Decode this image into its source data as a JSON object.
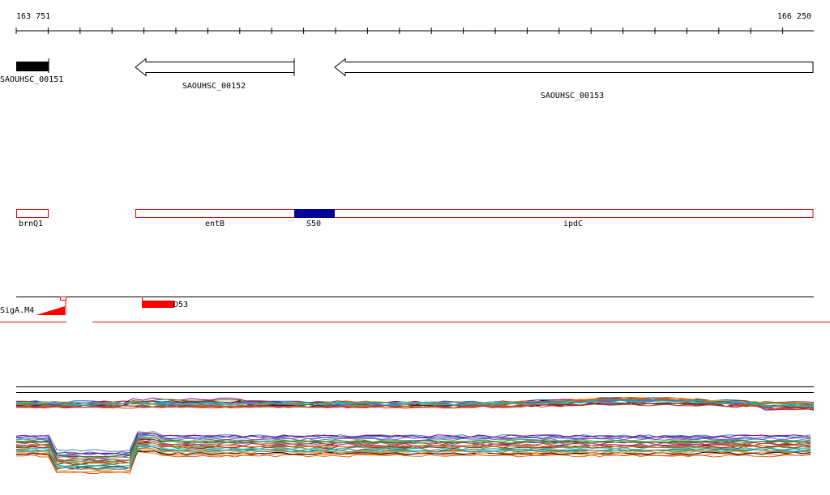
{
  "coordinates": {
    "start": "163 751",
    "end": "166 250"
  },
  "genes": [
    {
      "id": "SAOUHSC_00151",
      "strand": "+",
      "style": "filled"
    },
    {
      "id": "SAOUHSC_00152",
      "strand": "-",
      "style": "open-arrow"
    },
    {
      "id": "SAOUHSC_00153",
      "strand": "-",
      "style": "open-arrow"
    }
  ],
  "annotations": [
    {
      "name": "brnQ1",
      "color": "#e00000",
      "fill": "none"
    },
    {
      "name": "entB",
      "color": "#e00000",
      "fill": "none"
    },
    {
      "name": "S50",
      "color": "#e00000",
      "fill": "#000099"
    },
    {
      "name": "ipdC",
      "color": "#e00000",
      "fill": "none"
    }
  ],
  "features": [
    {
      "name": "SigA.M4",
      "color": "#ff0000"
    },
    {
      "name": "D53",
      "color": "#ff0000"
    }
  ],
  "colors": {
    "red": "#ff0000",
    "dark_red": "#e00000",
    "navy": "#000099",
    "black": "#000000"
  }
}
